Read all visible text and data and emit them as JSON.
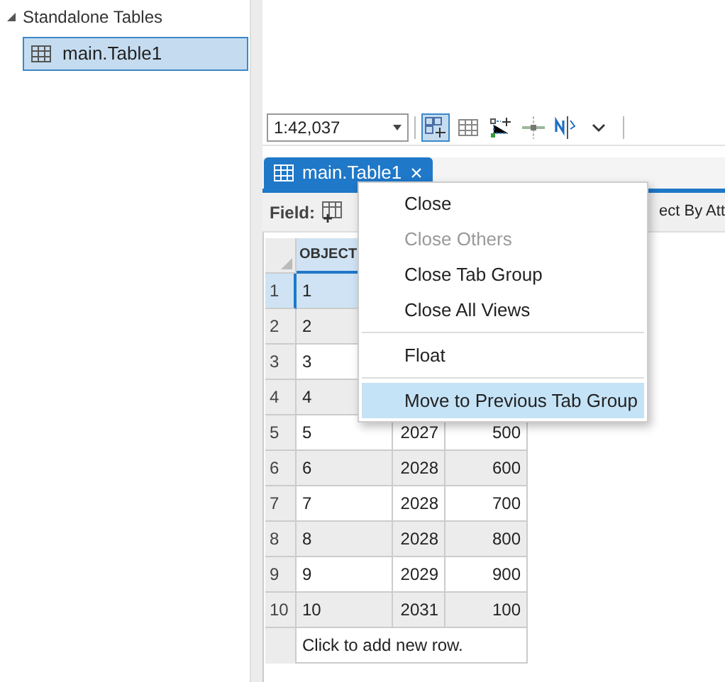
{
  "sidebar": {
    "group": {
      "label": "Standalone Tables",
      "expanded": true,
      "items": [
        {
          "label": "main.Table1",
          "selected": true
        }
      ]
    }
  },
  "toolbar": {
    "scale": "1:42,037",
    "tools": [
      {
        "kind": "select",
        "selected": true
      },
      {
        "kind": "grid",
        "selected": false
      },
      {
        "kind": "snap",
        "selected": false
      },
      {
        "kind": "guide",
        "selected": false
      },
      {
        "kind": "north",
        "selected": false
      },
      {
        "kind": "more",
        "selected": false
      }
    ]
  },
  "tab": {
    "label": "main.Table1",
    "close": "×"
  },
  "field_bar": {
    "label": "Field:",
    "cut_text": "ect By Att"
  },
  "table": {
    "columns": [
      "OBJECT"
    ],
    "rows": [
      {
        "num": "1",
        "selected": true,
        "cells": [
          "1"
        ]
      },
      {
        "num": "2",
        "selected": false,
        "cells": [
          "2"
        ]
      },
      {
        "num": "3",
        "selected": false,
        "cells": [
          "3"
        ]
      },
      {
        "num": "4",
        "selected": false,
        "cells": [
          "4"
        ]
      },
      {
        "num": "5",
        "selected": false,
        "cells": [
          "5",
          "2027",
          "500"
        ]
      },
      {
        "num": "6",
        "selected": false,
        "cells": [
          "6",
          "2028",
          "600"
        ]
      },
      {
        "num": "7",
        "selected": false,
        "cells": [
          "7",
          "2028",
          "700"
        ]
      },
      {
        "num": "8",
        "selected": false,
        "cells": [
          "8",
          "2028",
          "800"
        ]
      },
      {
        "num": "9",
        "selected": false,
        "cells": [
          "9",
          "2029",
          "900"
        ]
      },
      {
        "num": "10",
        "selected": false,
        "cells": [
          "10",
          "2031",
          "100"
        ]
      }
    ],
    "add_row": "Click to add new row."
  },
  "context_menu": [
    {
      "label": "Close",
      "disabled": false,
      "selected": false
    },
    {
      "label": "Close Others",
      "disabled": true,
      "selected": false
    },
    {
      "label": "Close Tab Group",
      "disabled": false,
      "selected": false
    },
    {
      "label": "Close All Views",
      "disabled": false,
      "selected": false,
      "divider_after": true
    },
    {
      "label": "Float",
      "disabled": false,
      "selected": false,
      "divider_after": true
    },
    {
      "label": "Move to Previous Tab Group",
      "disabled": false,
      "selected": true
    }
  ]
}
